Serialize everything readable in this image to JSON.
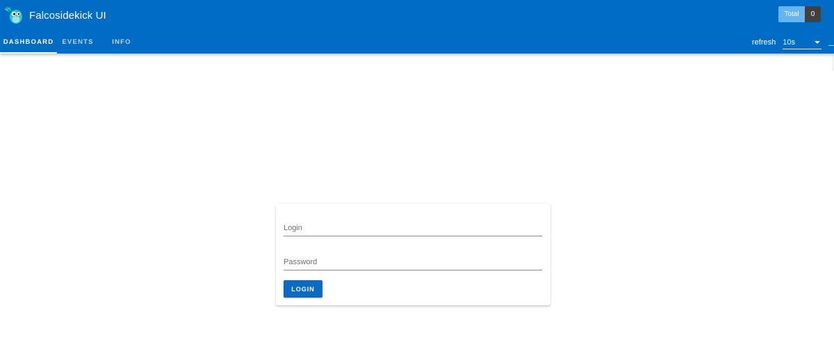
{
  "app": {
    "title": "Falcosidekick UI",
    "logo_icon": "falco-mascot-icon",
    "brand_color": "#006cc6"
  },
  "header": {
    "total_label": "Total",
    "total_count": "0"
  },
  "tabs": [
    {
      "label": "DASHBOARD",
      "active": true
    },
    {
      "label": "EVENTS",
      "active": false
    },
    {
      "label": "INFO",
      "active": false
    }
  ],
  "refresh": {
    "label": "refresh",
    "selected": "10s"
  },
  "login_form": {
    "login_placeholder": "Login",
    "login_value": "",
    "password_placeholder": "Password",
    "password_value": "",
    "submit_label": "LOGIN",
    "submit_color": "#0a6ac4"
  }
}
